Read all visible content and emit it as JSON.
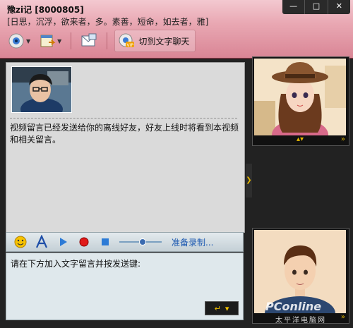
{
  "window": {
    "title": "豫zi记 [8000805]",
    "signature": "[日思，沉浮，欲来者，多。素善，短命，如去者，雅]",
    "controls": {
      "min": "—",
      "max": "□",
      "close": "✕"
    }
  },
  "toolbar": {
    "switch_label": "切到文字聊天",
    "icons": [
      "video-call-icon",
      "file-transfer-icon",
      "mail-icon",
      "vip-video-icon"
    ]
  },
  "chat": {
    "message": "视频留言已经发送给你的离线好友，好友上线时将看到本视频和相关留言。"
  },
  "recording": {
    "status_label": "准备录制...",
    "volume_fraction": 0.55
  },
  "input": {
    "text": "请在下方加入文字留言并按发送键:",
    "send_symbol": "↵",
    "send_caret": "▾"
  },
  "video": {
    "bar_mid": "▴▾",
    "bar_right": "»"
  },
  "watermark": {
    "main": "PConline",
    "sub": "太平洋电脑网"
  },
  "colors": {
    "titlebar": "#e9a8b3",
    "accent": "#e6b800",
    "link": "#1a57b0"
  }
}
